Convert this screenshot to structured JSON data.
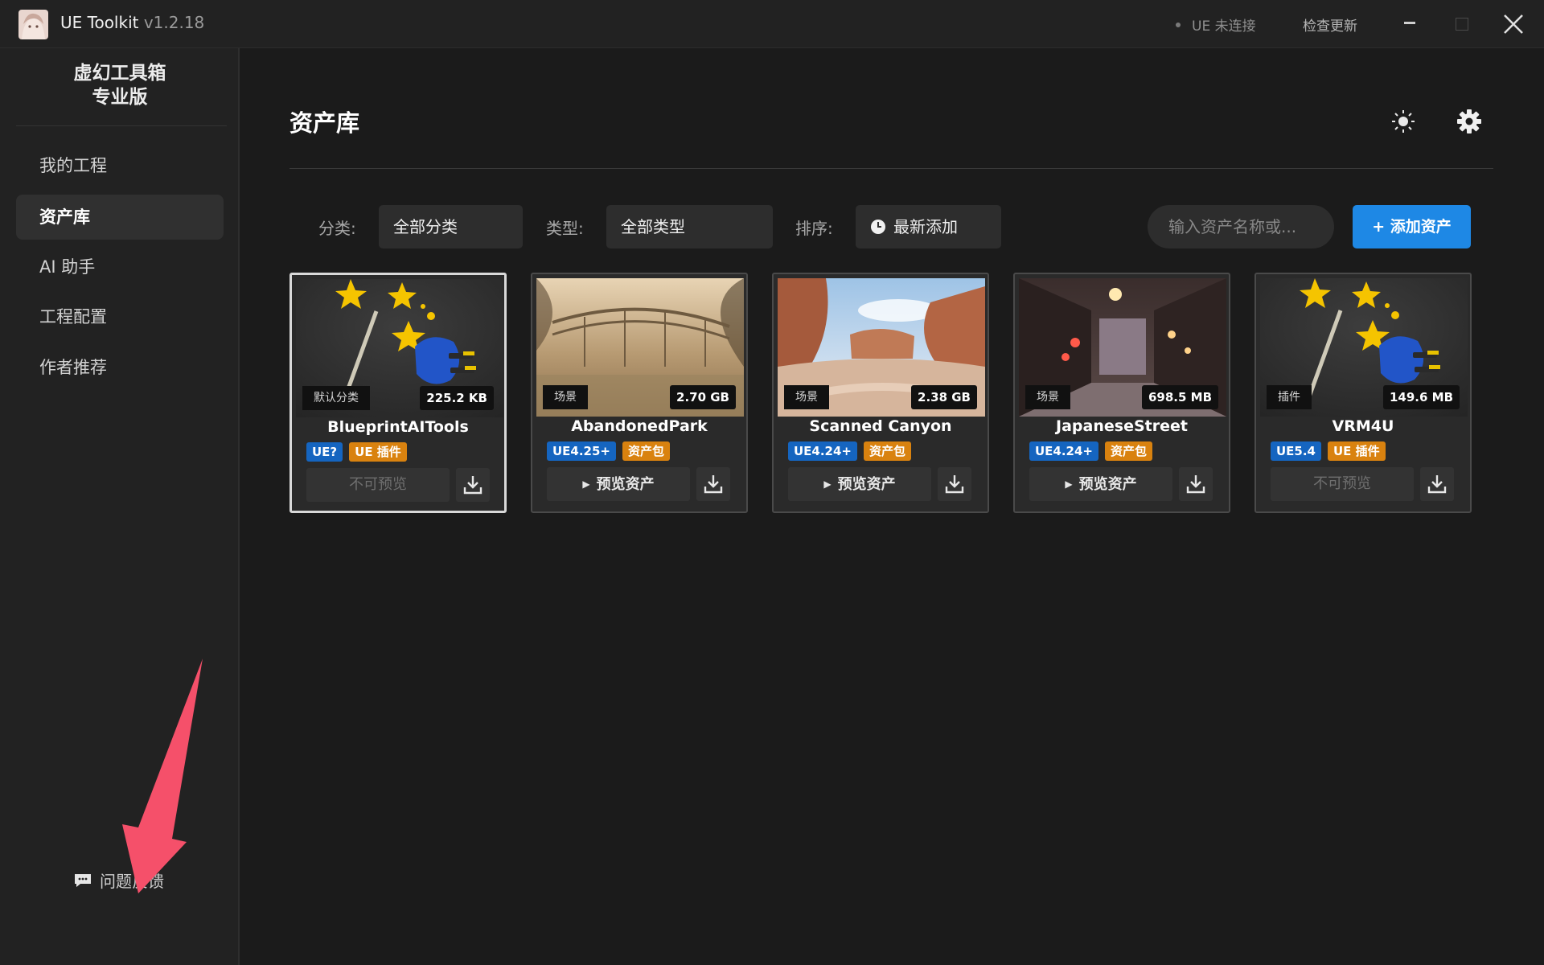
{
  "window": {
    "app_name": "UE Toolkit",
    "version": "v1.2.18",
    "ue_status": "UE 未连接",
    "check_update": "检查更新"
  },
  "sidebar": {
    "brand_line1": "虚幻工具箱",
    "brand_line2": "专业版",
    "items": [
      {
        "label": "我的工程",
        "active": false
      },
      {
        "label": "资产库",
        "active": true
      },
      {
        "label": "AI 助手",
        "active": false
      },
      {
        "label": "工程配置",
        "active": false
      },
      {
        "label": "作者推荐",
        "active": false
      }
    ],
    "feedback": "问题反馈"
  },
  "main": {
    "title": "资产库",
    "filters": {
      "category_label": "分类:",
      "category_value": "全部分类",
      "type_label": "类型:",
      "type_value": "全部类型",
      "sort_label": "排序:",
      "sort_value": "最新添加"
    },
    "search_placeholder": "输入资产名称或...",
    "add_button": "+ 添加资产",
    "cards": [
      {
        "name": "BlueprintAITools",
        "category": "默认分类",
        "size": "225.2 KB",
        "version_tag": "UE?",
        "type_tag": "UE 插件",
        "action": "不可预览",
        "action_enabled": false,
        "selected": true
      },
      {
        "name": "AbandonedPark",
        "category": "场景",
        "size": "2.70 GB",
        "version_tag": "UE4.25+",
        "type_tag": "资产包",
        "action": "预览资产",
        "action_enabled": true,
        "selected": false
      },
      {
        "name": "Scanned Canyon",
        "category": "场景",
        "size": "2.38 GB",
        "version_tag": "UE4.24+",
        "type_tag": "资产包",
        "action": "预览资产",
        "action_enabled": true,
        "selected": false
      },
      {
        "name": "JapaneseStreet",
        "category": "场景",
        "size": "698.5 MB",
        "version_tag": "UE4.24+",
        "type_tag": "资产包",
        "action": "预览资产",
        "action_enabled": true,
        "selected": false
      },
      {
        "name": "VRM4U",
        "category": "插件",
        "size": "149.6 MB",
        "version_tag": "UE5.4",
        "type_tag": "UE 插件",
        "action": "不可预览",
        "action_enabled": false,
        "selected": false
      }
    ]
  },
  "colors": {
    "accent": "#1e88e5",
    "version_tag": "#1565c0",
    "type_tag": "#d9820f",
    "annotation_arrow": "#f5506a"
  }
}
